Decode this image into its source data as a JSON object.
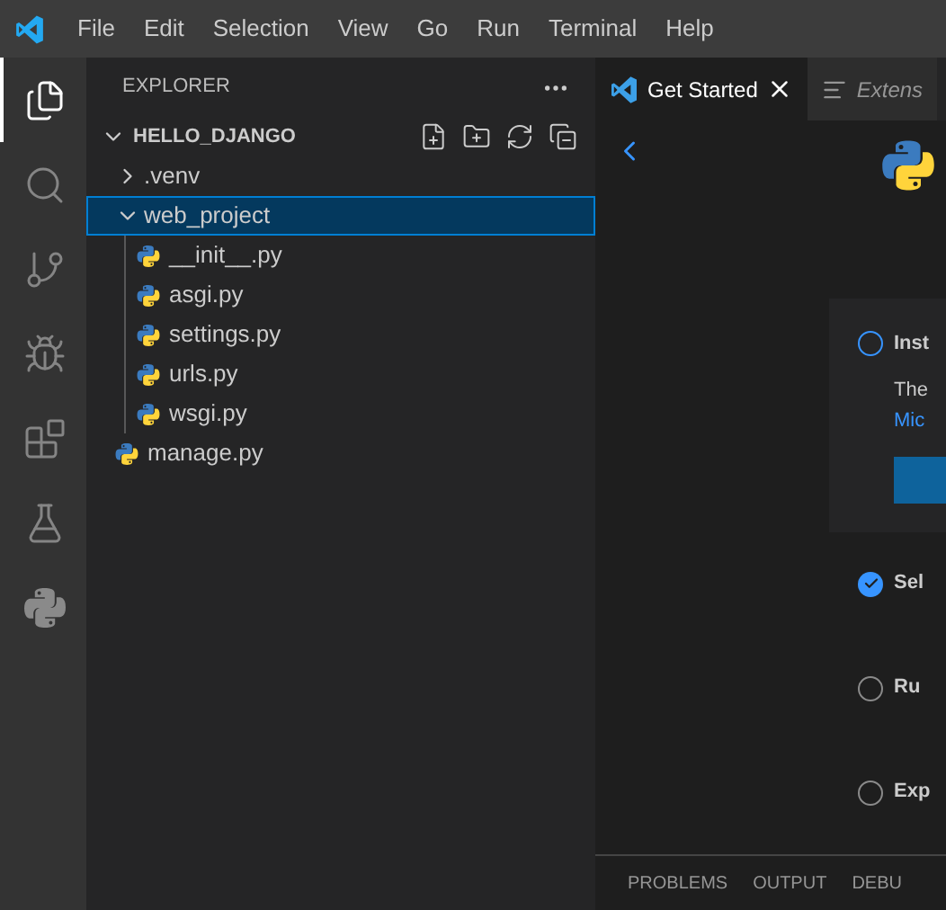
{
  "menu": [
    "File",
    "Edit",
    "Selection",
    "View",
    "Go",
    "Run",
    "Terminal",
    "Help"
  ],
  "activity_bar": [
    {
      "kind": "files",
      "selected": true
    },
    {
      "kind": "search",
      "selected": false
    },
    {
      "kind": "source-control",
      "selected": false
    },
    {
      "kind": "run-debug",
      "selected": false
    },
    {
      "kind": "extensions",
      "selected": false
    },
    {
      "kind": "testing",
      "selected": false
    },
    {
      "kind": "python",
      "selected": false
    }
  ],
  "explorer": {
    "title": "EXPLORER",
    "tree": {
      "label": "HELLO_DJANGO",
      "expanded": true,
      "children": [
        {
          "label": ".venv",
          "kind": "folder",
          "expanded": false,
          "selected": false
        },
        {
          "label": "web_project",
          "kind": "folder",
          "expanded": true,
          "selected": true,
          "children": [
            {
              "label": "__init__.py",
              "kind": "file",
              "selected": false
            },
            {
              "label": "asgi.py",
              "kind": "file",
              "selected": false
            },
            {
              "label": "settings.py",
              "kind": "file",
              "selected": false
            },
            {
              "label": "urls.py",
              "kind": "file",
              "selected": false
            },
            {
              "label": "wsgi.py",
              "kind": "file",
              "selected": false
            }
          ]
        },
        {
          "label": "manage.py",
          "kind": "file",
          "selected": false
        }
      ]
    }
  },
  "tabs": [
    {
      "label": "Get Started",
      "kind": "welcome",
      "selected": true
    },
    {
      "label": "Extens",
      "kind": "preview",
      "selected": false
    }
  ],
  "steps": [
    {
      "title": "Inst",
      "checked": false,
      "expanded": true,
      "description": "The",
      "link": "Mic"
    },
    {
      "title": "Sel",
      "checked": true,
      "expanded": false
    },
    {
      "title": "Ru",
      "checked": false,
      "expanded": false
    },
    {
      "title": "Exp",
      "checked": false,
      "expanded": false
    }
  ],
  "panel_tabs": [
    "PROBLEMS",
    "OUTPUT",
    "DEBU"
  ]
}
